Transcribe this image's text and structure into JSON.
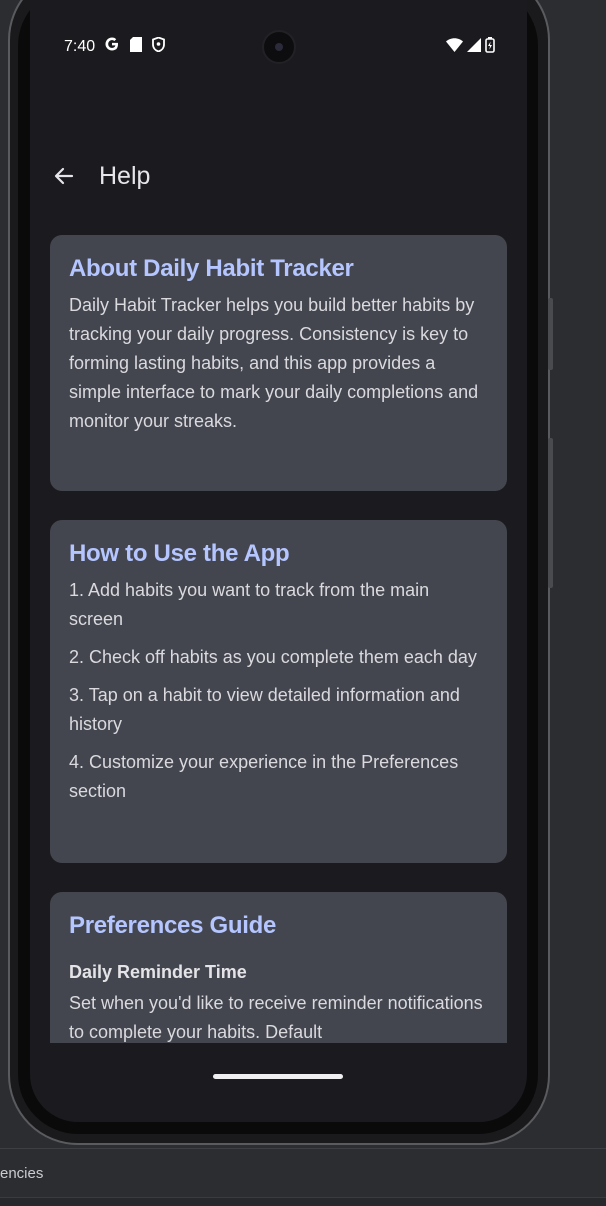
{
  "ide": {
    "bottom_label": "encies"
  },
  "status_bar": {
    "time": "7:40",
    "left_icons": [
      "google-icon",
      "sd-card-icon",
      "shield-icon"
    ],
    "right_icons": [
      "wifi-icon",
      "signal-icon",
      "battery-charging-icon"
    ]
  },
  "app_bar": {
    "title": "Help",
    "back_icon": "arrow-left-icon"
  },
  "cards": {
    "about": {
      "title": "About Daily Habit Tracker",
      "body": "Daily Habit Tracker helps you build better habits by tracking your daily progress. Consistency is key to forming lasting habits, and this app provides a simple interface to mark your daily completions and monitor your streaks."
    },
    "how_to": {
      "title": "How to Use the App",
      "steps": [
        "1. Add habits you want to track from the main screen",
        "2. Check off habits as you complete them each day",
        "3. Tap on a habit to view detailed information and history",
        "4. Customize your experience in the Preferences section"
      ]
    },
    "preferences": {
      "title": "Preferences Guide",
      "subheading": "Daily Reminder Time",
      "body": "Set when you'd like to receive reminder notifications to complete your habits. Default"
    }
  },
  "colors": {
    "card_bg": "#44464f",
    "title_accent": "#b4c5ff",
    "screen_bg": "#1b1b1f"
  }
}
